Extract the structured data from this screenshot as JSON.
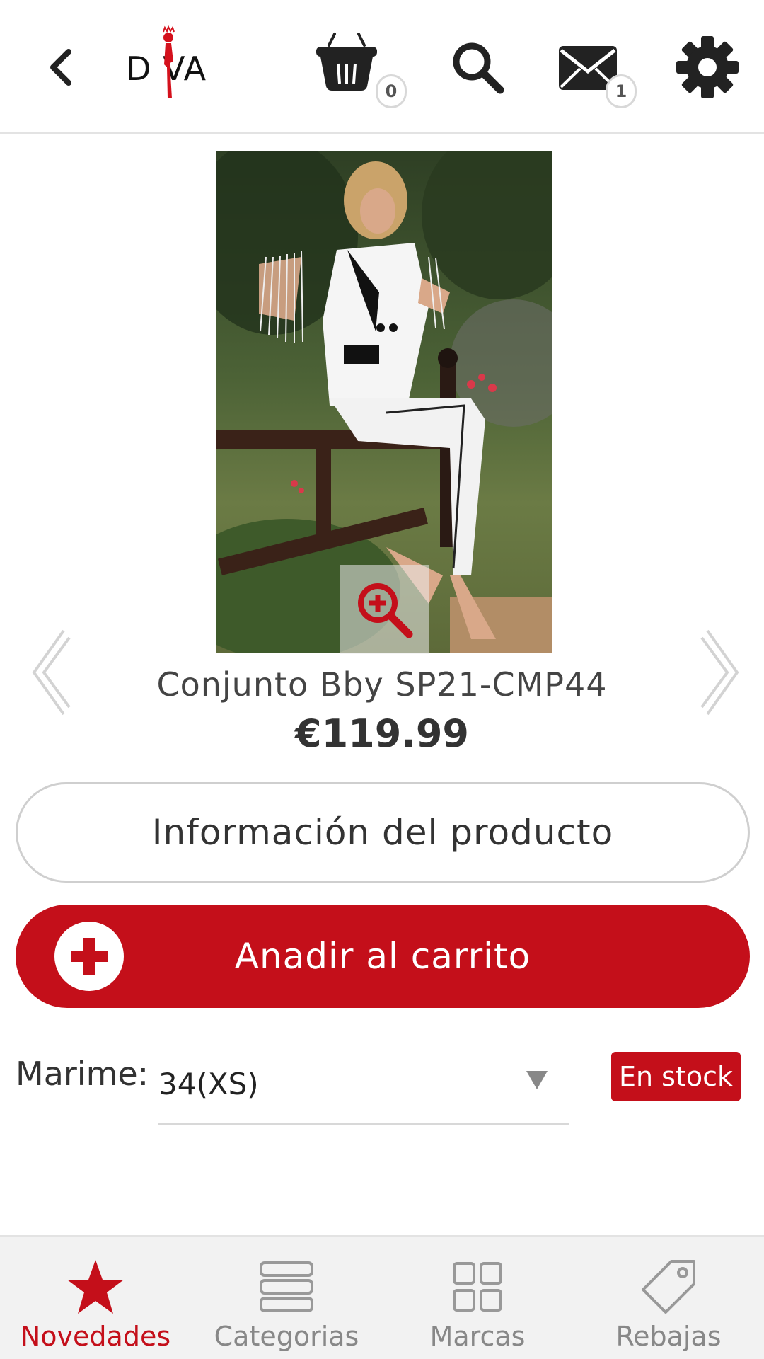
{
  "header": {
    "logo_text": "D VA",
    "cart_count": "0",
    "messages_count": "1"
  },
  "product": {
    "name": "Conjunto Bby SP21-CMP44",
    "price": "€119.99"
  },
  "actions": {
    "info_label": "Información del producto",
    "add_to_cart_label": "Anadir al carrito"
  },
  "size": {
    "label": "Marime:",
    "value": "34(XS)",
    "stock": "En stock"
  },
  "bottom_nav": {
    "tabs": [
      {
        "label": "Novedades",
        "icon": "star-icon",
        "active": true
      },
      {
        "label": "Categorias",
        "icon": "list-icon",
        "active": false
      },
      {
        "label": "Marcas",
        "icon": "grid-icon",
        "active": false
      },
      {
        "label": "Rebajas",
        "icon": "tag-icon",
        "active": false
      }
    ]
  },
  "colors": {
    "accent": "#c40f1a",
    "inactive": "#888888"
  }
}
